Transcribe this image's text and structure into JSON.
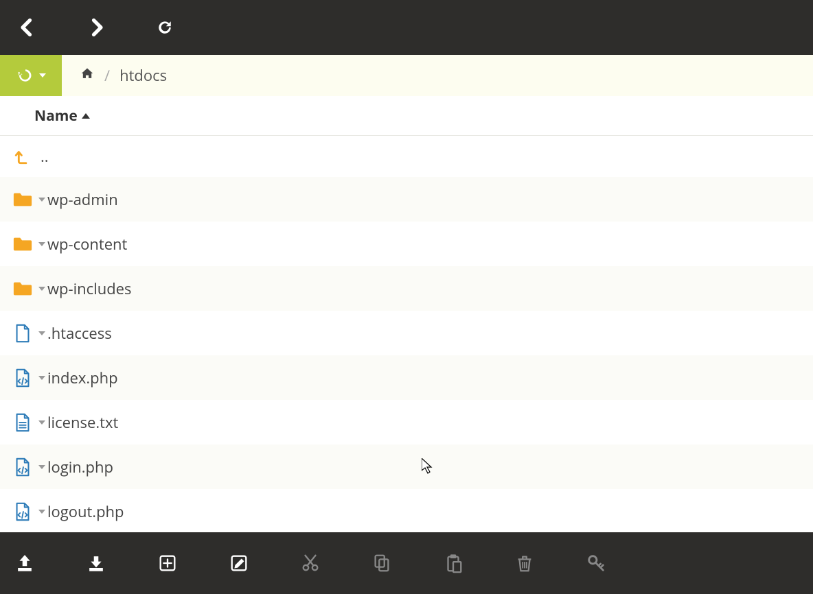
{
  "breadcrumb": {
    "home_label": "home",
    "separator": "/",
    "current": "htdocs"
  },
  "column": {
    "name": "Name"
  },
  "up_row": {
    "label": ".."
  },
  "rows": [
    {
      "type": "folder",
      "name": "wp-admin"
    },
    {
      "type": "folder",
      "name": "wp-content"
    },
    {
      "type": "folder",
      "name": "wp-includes"
    },
    {
      "type": "file",
      "name": ".htaccess"
    },
    {
      "type": "code",
      "name": "index.php"
    },
    {
      "type": "text",
      "name": "license.txt"
    },
    {
      "type": "code",
      "name": "login.php"
    },
    {
      "type": "code",
      "name": "logout.php"
    }
  ],
  "bottom_actions": [
    {
      "id": "upload",
      "enabled": true
    },
    {
      "id": "download",
      "enabled": true
    },
    {
      "id": "new",
      "enabled": true
    },
    {
      "id": "edit",
      "enabled": true
    },
    {
      "id": "cut",
      "enabled": false
    },
    {
      "id": "copy",
      "enabled": false
    },
    {
      "id": "paste",
      "enabled": false
    },
    {
      "id": "delete",
      "enabled": false
    },
    {
      "id": "permissions",
      "enabled": false
    }
  ]
}
